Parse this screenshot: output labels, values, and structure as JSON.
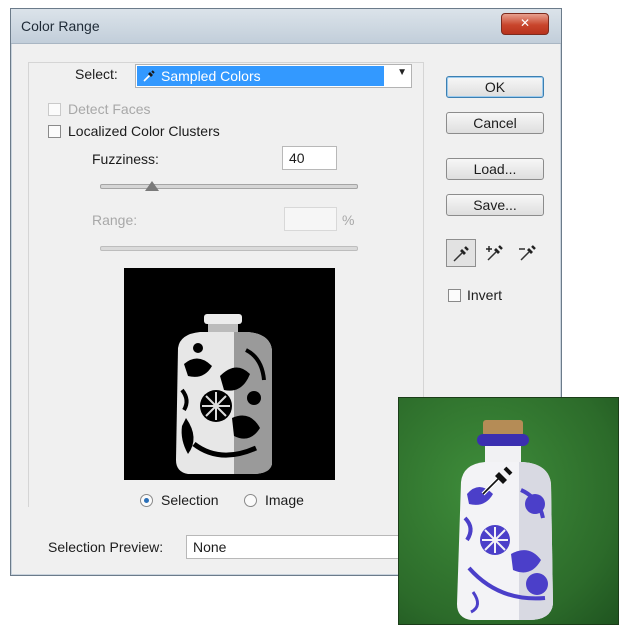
{
  "window": {
    "title": "Color Range",
    "close_glyph": "✕"
  },
  "select": {
    "label": "Select:",
    "value": "Sampled Colors",
    "icon": "eyedropper-icon"
  },
  "detect_faces": {
    "label": "Detect Faces",
    "checked": false,
    "enabled": false
  },
  "localized_clusters": {
    "label": "Localized Color Clusters",
    "checked": false
  },
  "fuzziness": {
    "label": "Fuzziness:",
    "value": "40",
    "slider_fraction": 0.2
  },
  "range": {
    "label": "Range:",
    "value": "",
    "unit": "%",
    "enabled": false
  },
  "view": {
    "selection_label": "Selection",
    "image_label": "Image",
    "selected": "selection"
  },
  "buttons": {
    "ok": "OK",
    "cancel": "Cancel",
    "load": "Load...",
    "save": "Save..."
  },
  "tools": [
    "eyedropper-icon",
    "eyedropper-plus-icon",
    "eyedropper-minus-icon"
  ],
  "invert": {
    "label": "Invert",
    "checked": false
  },
  "selection_preview": {
    "label": "Selection Preview:",
    "value": "None"
  },
  "colors": {
    "highlight": "#3399ff",
    "photo_green": "#2f7a2d",
    "pattern_blue": "#4b3fc9"
  }
}
